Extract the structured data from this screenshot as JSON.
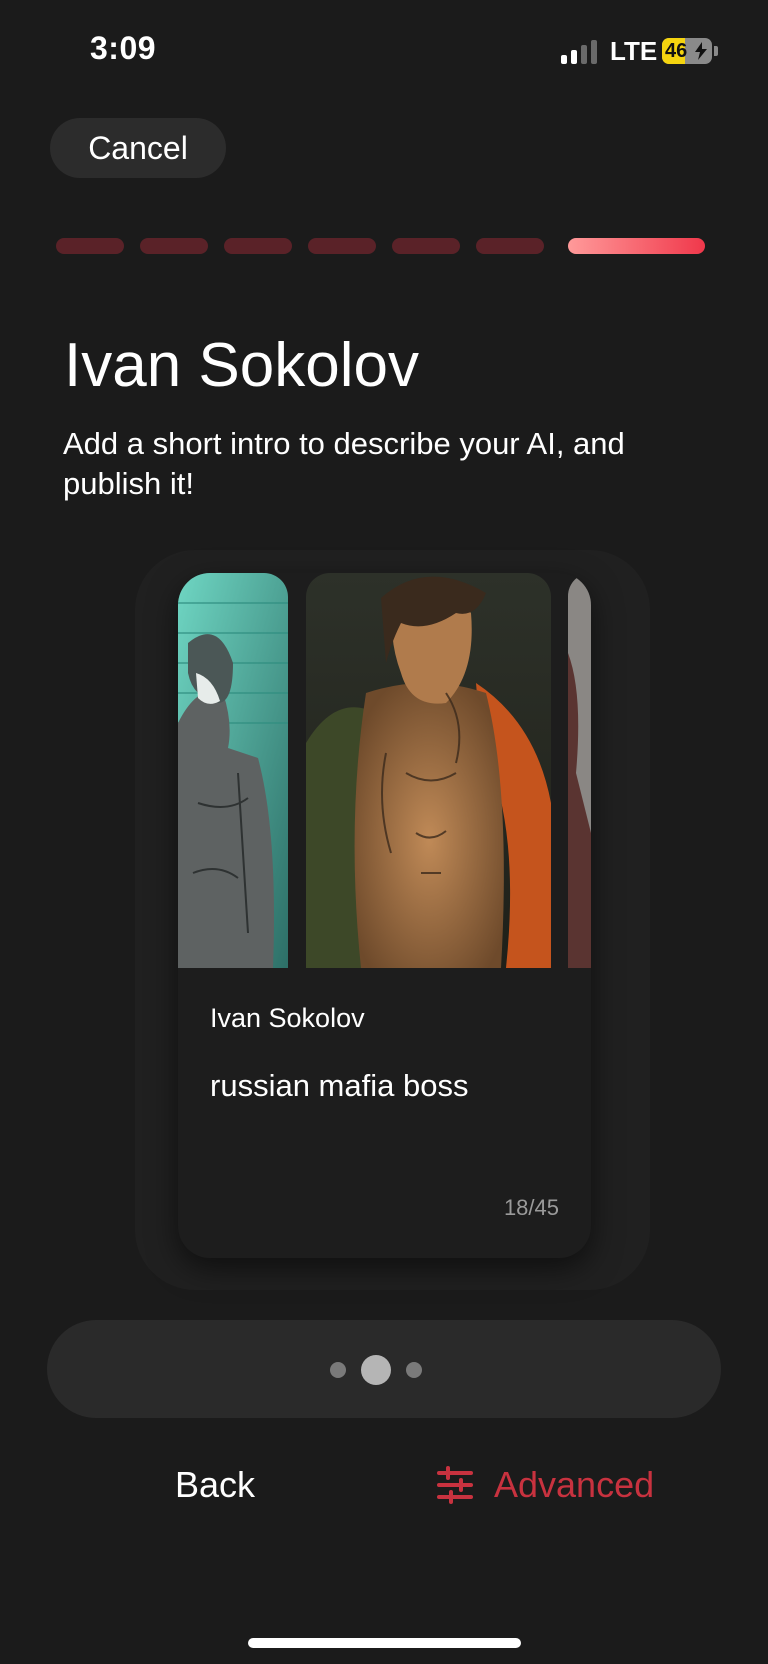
{
  "status_bar": {
    "time": "3:09",
    "network": "LTE",
    "battery": "46",
    "battery_level": 0.46,
    "signal_bars_active": 2,
    "signal_bars_total": 4
  },
  "header": {
    "cancel_label": "Cancel"
  },
  "progress": {
    "total_steps": 7,
    "current_step": 7,
    "inactive_color": "#5a2228",
    "active_color": "#f0384b"
  },
  "page": {
    "title": "Ivan Sokolov",
    "subtitle": "Add a short intro to describe your AI, and publish it!"
  },
  "preview_card": {
    "name": "Ivan Sokolov",
    "intro": "russian mafia boss",
    "char_count": "18/45"
  },
  "pager": {
    "pages": 3,
    "active_index": 1
  },
  "footer": {
    "back_label": "Back",
    "advanced_label": "Advanced",
    "accent_color": "#c8323f"
  },
  "icons": {
    "advanced": "sliders-icon",
    "signal": "cellular-signal-icon",
    "battery": "battery-charging-icon"
  }
}
